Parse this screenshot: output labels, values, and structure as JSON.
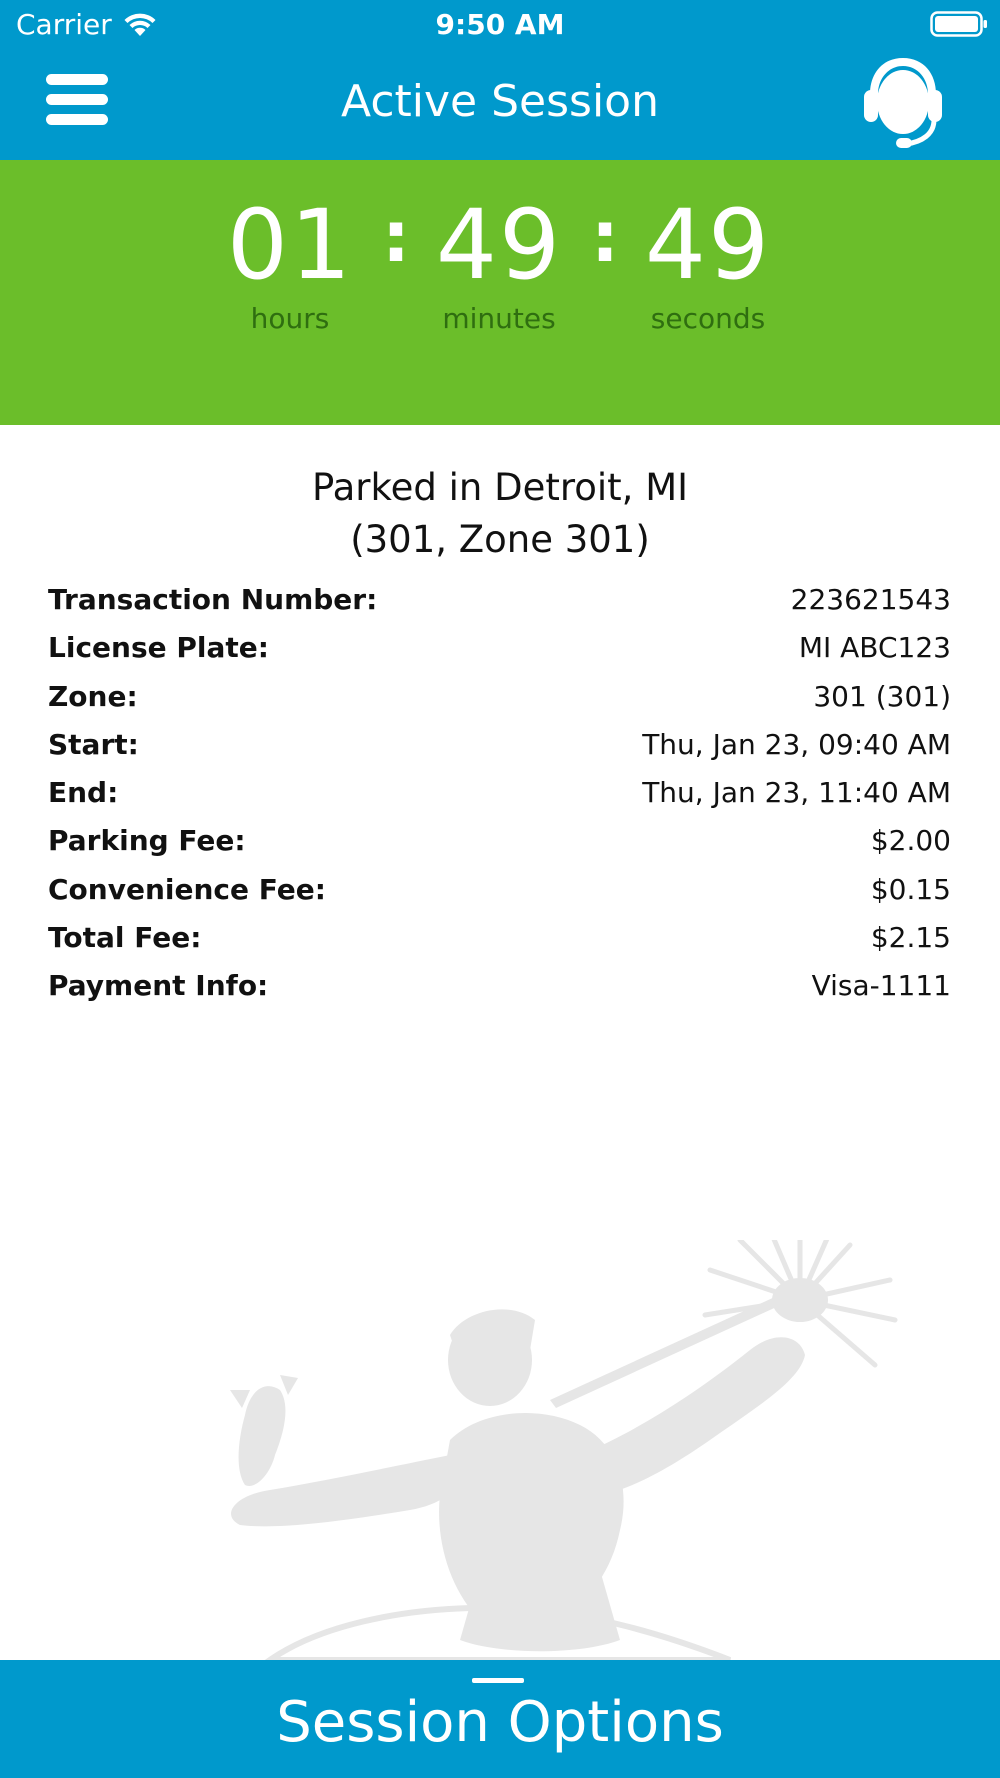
{
  "status_bar": {
    "carrier": "Carrier",
    "time": "9:50 AM"
  },
  "nav": {
    "title": "Active Session",
    "menu_icon": "hamburger-menu-icon",
    "support_icon": "headset-icon"
  },
  "timer": {
    "hours": "01",
    "minutes": "49",
    "seconds": "49",
    "hours_label": "hours",
    "minutes_label": "minutes",
    "seconds_label": "seconds",
    "separator": ":"
  },
  "session": {
    "location_line1": "Parked in Detroit, MI",
    "location_line2": "(301, Zone 301)",
    "rows": [
      {
        "label": "Transaction Number:",
        "value": "223621543"
      },
      {
        "label": "License Plate:",
        "value": "MI ABC123"
      },
      {
        "label": "Zone:",
        "value": "301 (301)"
      },
      {
        "label": "Start:",
        "value": "Thu, Jan 23, 09:40 AM"
      },
      {
        "label": "End:",
        "value": "Thu, Jan 23, 11:40 AM"
      },
      {
        "label": "Parking Fee:",
        "value": "$2.00"
      },
      {
        "label": "Convenience Fee:",
        "value": "$0.15"
      },
      {
        "label": "Total Fee:",
        "value": "$2.15"
      },
      {
        "label": "Payment Info:",
        "value": "Visa-1111"
      }
    ]
  },
  "bottom": {
    "label": "Session Options"
  },
  "colors": {
    "brand_blue": "#0099CC",
    "timer_green": "#6BBE2A",
    "timer_label": "#2F6E10",
    "watermark": "#E6E6E6"
  }
}
